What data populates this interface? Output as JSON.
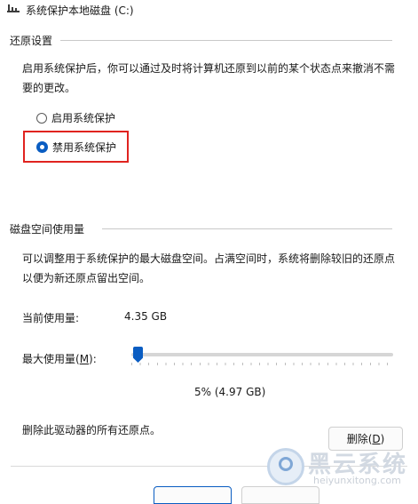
{
  "window": {
    "title": "系统保护本地磁盘 (C:)"
  },
  "restore_settings": {
    "group_title": "还原设置",
    "description_line1": "启用系统保护后，你可以通过及时将计算机还原到以前的某个状态点来撤消不需",
    "description_line2": "要的更改。",
    "option_enable": "启用系统保护",
    "option_disable": "禁用系统保护",
    "selected": "禁用系统保护"
  },
  "disk_usage": {
    "group_title": "磁盘空间使用量",
    "description_line1": "可以调整用于系统保护的最大磁盘空间。占满空间时，系统将删除较旧的还原点",
    "description_line2": "以便为新还原点留出空间。",
    "current_label": "当前使用量:",
    "current_value": "4.35 GB",
    "max_label_prefix": "最大使用量(",
    "max_label_key": "M",
    "max_label_suffix": "):",
    "max_percent": 5,
    "max_readout": "5% (4.97 GB)",
    "delete_text": "删除此驱动器的所有还原点。",
    "delete_button_prefix": "删除(",
    "delete_button_key": "D",
    "delete_button_suffix": ")"
  },
  "watermark": {
    "brand": "黑云系统",
    "url": "heiyunxitong.com"
  },
  "colors": {
    "accent": "#0a5dc2",
    "highlight": "#e0231f"
  }
}
